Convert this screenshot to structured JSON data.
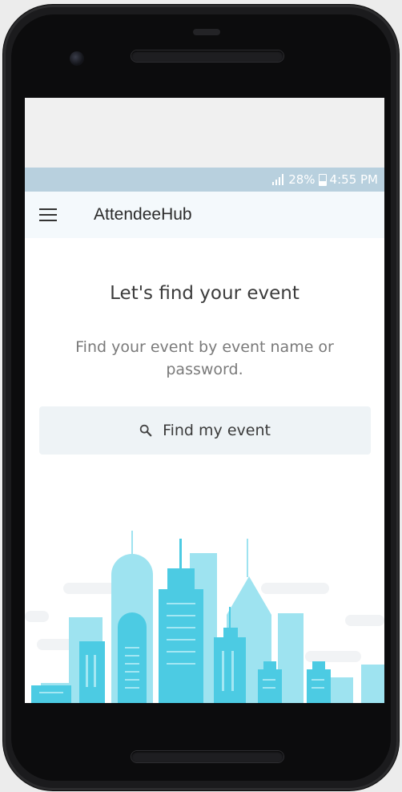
{
  "status_bar": {
    "battery": "28%",
    "time": "4:55 PM"
  },
  "app_bar": {
    "title": "AttendeeHub",
    "menu_icon": "hamburger-menu-icon"
  },
  "main": {
    "heading": "Let's find your event",
    "subtext": "Find your event by event name or password.",
    "find_button": {
      "label": "Find my event",
      "icon": "search-icon"
    }
  },
  "colors": {
    "status_bar": "#b8d0de",
    "app_bar": "#f4f9fc",
    "button_bg": "#eef3f6",
    "city_light": "#9ee3f0",
    "city_dark": "#4ccbe3"
  }
}
